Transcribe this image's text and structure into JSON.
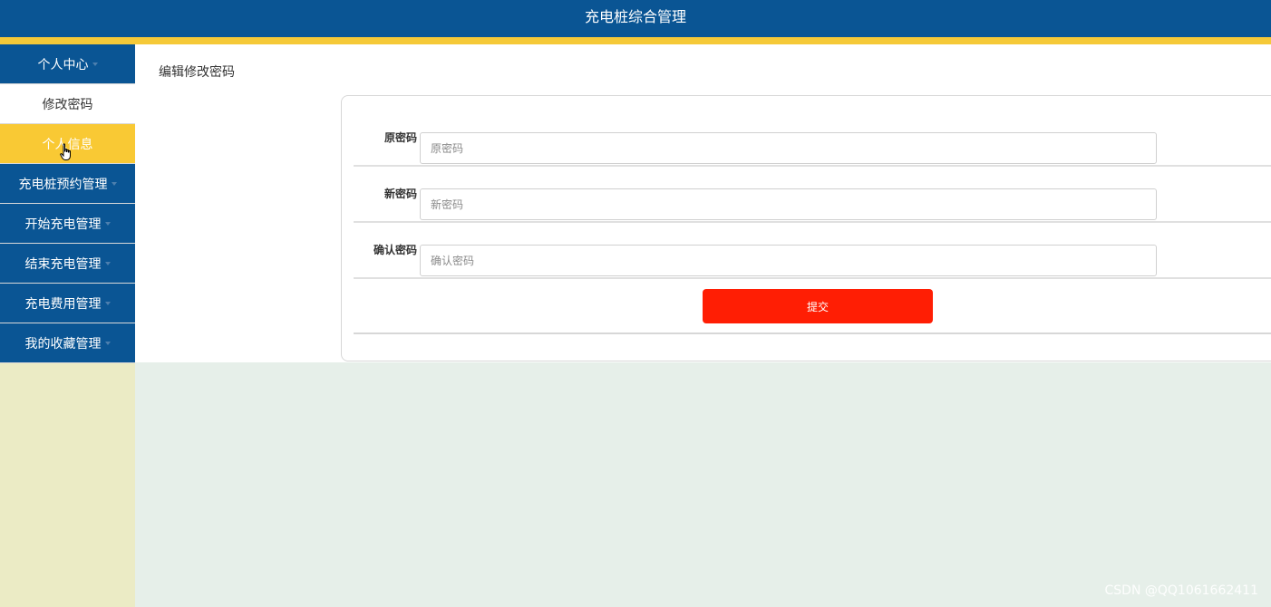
{
  "header": {
    "title": "充电桩综合管理"
  },
  "sidebar": {
    "items": [
      {
        "label": "个人中心",
        "type": "group"
      },
      {
        "label": "修改密码",
        "type": "sub"
      },
      {
        "label": "个人信息",
        "type": "sub-active"
      },
      {
        "label": "充电桩预约管理",
        "type": "group"
      },
      {
        "label": "开始充电管理",
        "type": "group"
      },
      {
        "label": "结束充电管理",
        "type": "group"
      },
      {
        "label": "充电费用管理",
        "type": "group"
      },
      {
        "label": "我的收藏管理",
        "type": "group"
      }
    ]
  },
  "main": {
    "title": "编辑修改密码",
    "form": {
      "old_password": {
        "label": "原密码",
        "placeholder": "原密码",
        "value": ""
      },
      "new_password": {
        "label": "新密码",
        "placeholder": "新密码",
        "value": ""
      },
      "confirm_password": {
        "label": "确认密码",
        "placeholder": "确认密码",
        "value": ""
      },
      "submit_label": "提交"
    }
  },
  "watermark": "CSDN @QQ1061662411",
  "colors": {
    "header": "#0a5594",
    "accent_yellow": "#f5c938",
    "submit": "#ff1e04",
    "sidebar_bg": "#ebebc5",
    "page_bg": "#e6efe9"
  }
}
